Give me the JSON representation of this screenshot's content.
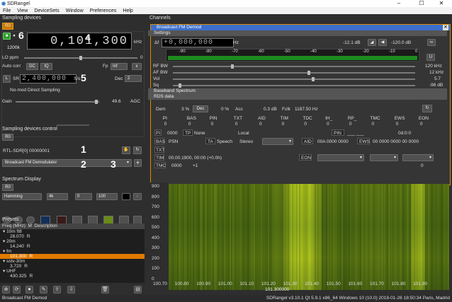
{
  "window": {
    "title": "SDRangel",
    "controls": [
      "–",
      "☐",
      "✕"
    ]
  },
  "menu": [
    "File",
    "View",
    "DeviceSets",
    "Window",
    "Preferences",
    "Help"
  ],
  "sampling": {
    "dock_title": "Sampling devices",
    "tab": "R0",
    "freq_digits": "0,101,300",
    "freq_unit": "kHz",
    "samplerate": "1200k",
    "lo_ppm_label": "LO ppm",
    "lo_ppm_value": "0",
    "autocorr_label": "Auto corr",
    "dc": "DC",
    "iq": "IQ",
    "fp_label": "Fp",
    "fp_value": "Inf",
    "x_btn": "x",
    "l_btn": "L",
    "sr_label": "SR",
    "sr_value": "2,400,000",
    "sr_unit": "S/s",
    "dec_label": "Dec",
    "dec_value": "2",
    "nomod": "No-mod Direct Sampling",
    "gain_label": "Gain",
    "gain_value": "49.6",
    "agc": "AGC"
  },
  "control": {
    "dock_title": "Sampling devices control",
    "tab": "R0",
    "device": "RTL-SDR[0] 00000001",
    "demod": "Broadcast FM Demodulator",
    "plus": "+"
  },
  "spectrum_display": {
    "dock_title": "Spectrum Display",
    "tab": "R0",
    "window": "Hamming",
    "fft": "4k",
    "zero": "0",
    "hundred": "100"
  },
  "presets": {
    "dock_title": "Presets",
    "col_freq": "Freq (MHz)",
    "col_m": "M",
    "col_desc": "Description",
    "rows": [
      {
        "text": "10m ft8",
        "indent": 0,
        "group": true
      },
      {
        "text": "28.070",
        "mode": "R",
        "indent": 1
      },
      {
        "text": "20m",
        "indent": 0,
        "group": true
      },
      {
        "text": "14.240",
        "mode": "R",
        "indent": 1
      },
      {
        "text": "fm",
        "indent": 0,
        "group": true
      },
      {
        "text": "101.300",
        "mode": "R",
        "indent": 1,
        "selected": true
      },
      {
        "text": "sstv-30m",
        "indent": 0,
        "group": true
      },
      {
        "text": "3.720",
        "mode": "R",
        "indent": 1
      },
      {
        "text": "UHF",
        "indent": 0,
        "group": true
      },
      {
        "text": "430.325",
        "mode": "R",
        "indent": 1
      }
    ]
  },
  "annotations": [
    "6",
    "4",
    "5",
    "1",
    "2",
    "3"
  ],
  "channels": {
    "dock_title": "Channels",
    "title": "Broadcast FM Demod",
    "settings": "Settings",
    "delta_label": "Δf",
    "delta_value": "+0,000,000",
    "hz": "Hz",
    "db1": "-12.1 dB",
    "db2": "-120.0 dB",
    "scale": [
      "-90",
      "-80",
      "-70",
      "-60",
      "-50",
      "-40",
      "-30",
      "-20",
      "-10",
      "0"
    ],
    "u_btn": "U",
    "rfbw_label": "RF BW",
    "rfbw_value": "120 kHz",
    "afbw_label": "AF BW",
    "afbw_value": "12 kHz",
    "vol_label": "Vol",
    "vol_value": "5.7",
    "sq_label": "Sq",
    "sq_value": "-96 dB",
    "baseband": "Baseband Spectrum",
    "rds": "RDS data",
    "dem_label": "Dem",
    "dem_pct": "3 %",
    "dec_btn": "Dec",
    "acc_pct": "0 %",
    "acc_label": "Acc",
    "fclk_db": "0.3 dB",
    "fclk_label": "Fclk",
    "fclk_value": "1187.50 Hz",
    "headers": [
      "PI",
      "BAS",
      "PIN",
      "TXT",
      "AID",
      "TIM",
      "TDC",
      "IH_",
      "RP_",
      "TMC",
      "EWS",
      "EON"
    ],
    "counts": [
      "0",
      "0",
      "0",
      "0",
      "0",
      "0",
      "0",
      "0",
      "0",
      "0",
      "0",
      "0"
    ],
    "pi_label": "PI",
    "pi_value": "0000",
    "tp_label": "TP",
    "tp_value": "None",
    "local": "Local",
    "pin_label": "PIN",
    "pin_value": "___ ___",
    "time_code": "0d:0:0",
    "bas_label": "BAS",
    "psn_label": "PSN",
    "ta_label": "TA",
    "speech": "Speech",
    "stereo": "Stereo",
    "aid_label": "AID",
    "aid_value": "00A 0000 0000",
    "ews_label": "EWS",
    "ews_value": "00 0000 0000 00 0000",
    "txt_label": "TXT",
    "tim_label": "TIM",
    "tim_value": "00.00.1900, 00:00 (+0.0h)",
    "eon_label": "EON",
    "tmc_label": "TMC",
    "tmc_value1": "0000",
    "tmc_value2": "+1",
    "tmc_zero": "0"
  },
  "waterfall": {
    "y_ticks": [
      "900",
      "800",
      "700",
      "600",
      "500",
      "400",
      "300",
      "200",
      "100",
      "0"
    ],
    "x_ticks": [
      "100.70",
      "100.80",
      "100.90",
      "101.00",
      "101.10",
      "101.20",
      "101.30",
      "101.40",
      "101.50",
      "101.60",
      "101.70",
      "101.80",
      "101.90"
    ],
    "center": "101.300000"
  },
  "status": {
    "left": "Broadcast FM Demod",
    "right": "SDRangel v3.10.1 Qt 5.9.1 x86_64 Windows 10 (10.0)  2018-01-26 18:50:34 Paris, Madrid"
  }
}
